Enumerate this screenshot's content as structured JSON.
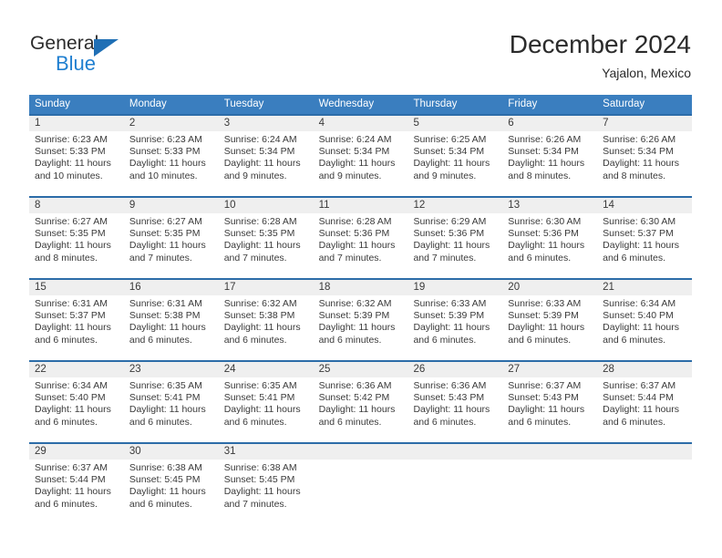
{
  "brand": {
    "name_part1": "General",
    "name_part2": "Blue",
    "triangle_icon": "triangle-icon",
    "accent_dark_blue": "#1f6fb5",
    "accent_blue": "#1f7fd0"
  },
  "header": {
    "title": "December 2024",
    "subtitle": "Yajalon, Mexico"
  },
  "theme": {
    "header_row_bg": "#3a7ebf",
    "cell_top_border": "#2c6ca8",
    "day_number_band_bg": "#efefef",
    "text": "#3a3a3a"
  },
  "calendar": {
    "weekday_headers": [
      "Sunday",
      "Monday",
      "Tuesday",
      "Wednesday",
      "Thursday",
      "Friday",
      "Saturday"
    ],
    "weeks": [
      [
        {
          "day": "1",
          "sunrise": "Sunrise: 6:23 AM",
          "sunset": "Sunset: 5:33 PM",
          "daylight_line1": "Daylight: 11 hours",
          "daylight_line2": "and 10 minutes."
        },
        {
          "day": "2",
          "sunrise": "Sunrise: 6:23 AM",
          "sunset": "Sunset: 5:33 PM",
          "daylight_line1": "Daylight: 11 hours",
          "daylight_line2": "and 10 minutes."
        },
        {
          "day": "3",
          "sunrise": "Sunrise: 6:24 AM",
          "sunset": "Sunset: 5:34 PM",
          "daylight_line1": "Daylight: 11 hours",
          "daylight_line2": "and 9 minutes."
        },
        {
          "day": "4",
          "sunrise": "Sunrise: 6:24 AM",
          "sunset": "Sunset: 5:34 PM",
          "daylight_line1": "Daylight: 11 hours",
          "daylight_line2": "and 9 minutes."
        },
        {
          "day": "5",
          "sunrise": "Sunrise: 6:25 AM",
          "sunset": "Sunset: 5:34 PM",
          "daylight_line1": "Daylight: 11 hours",
          "daylight_line2": "and 9 minutes."
        },
        {
          "day": "6",
          "sunrise": "Sunrise: 6:26 AM",
          "sunset": "Sunset: 5:34 PM",
          "daylight_line1": "Daylight: 11 hours",
          "daylight_line2": "and 8 minutes."
        },
        {
          "day": "7",
          "sunrise": "Sunrise: 6:26 AM",
          "sunset": "Sunset: 5:34 PM",
          "daylight_line1": "Daylight: 11 hours",
          "daylight_line2": "and 8 minutes."
        }
      ],
      [
        {
          "day": "8",
          "sunrise": "Sunrise: 6:27 AM",
          "sunset": "Sunset: 5:35 PM",
          "daylight_line1": "Daylight: 11 hours",
          "daylight_line2": "and 8 minutes."
        },
        {
          "day": "9",
          "sunrise": "Sunrise: 6:27 AM",
          "sunset": "Sunset: 5:35 PM",
          "daylight_line1": "Daylight: 11 hours",
          "daylight_line2": "and 7 minutes."
        },
        {
          "day": "10",
          "sunrise": "Sunrise: 6:28 AM",
          "sunset": "Sunset: 5:35 PM",
          "daylight_line1": "Daylight: 11 hours",
          "daylight_line2": "and 7 minutes."
        },
        {
          "day": "11",
          "sunrise": "Sunrise: 6:28 AM",
          "sunset": "Sunset: 5:36 PM",
          "daylight_line1": "Daylight: 11 hours",
          "daylight_line2": "and 7 minutes."
        },
        {
          "day": "12",
          "sunrise": "Sunrise: 6:29 AM",
          "sunset": "Sunset: 5:36 PM",
          "daylight_line1": "Daylight: 11 hours",
          "daylight_line2": "and 7 minutes."
        },
        {
          "day": "13",
          "sunrise": "Sunrise: 6:30 AM",
          "sunset": "Sunset: 5:36 PM",
          "daylight_line1": "Daylight: 11 hours",
          "daylight_line2": "and 6 minutes."
        },
        {
          "day": "14",
          "sunrise": "Sunrise: 6:30 AM",
          "sunset": "Sunset: 5:37 PM",
          "daylight_line1": "Daylight: 11 hours",
          "daylight_line2": "and 6 minutes."
        }
      ],
      [
        {
          "day": "15",
          "sunrise": "Sunrise: 6:31 AM",
          "sunset": "Sunset: 5:37 PM",
          "daylight_line1": "Daylight: 11 hours",
          "daylight_line2": "and 6 minutes."
        },
        {
          "day": "16",
          "sunrise": "Sunrise: 6:31 AM",
          "sunset": "Sunset: 5:38 PM",
          "daylight_line1": "Daylight: 11 hours",
          "daylight_line2": "and 6 minutes."
        },
        {
          "day": "17",
          "sunrise": "Sunrise: 6:32 AM",
          "sunset": "Sunset: 5:38 PM",
          "daylight_line1": "Daylight: 11 hours",
          "daylight_line2": "and 6 minutes."
        },
        {
          "day": "18",
          "sunrise": "Sunrise: 6:32 AM",
          "sunset": "Sunset: 5:39 PM",
          "daylight_line1": "Daylight: 11 hours",
          "daylight_line2": "and 6 minutes."
        },
        {
          "day": "19",
          "sunrise": "Sunrise: 6:33 AM",
          "sunset": "Sunset: 5:39 PM",
          "daylight_line1": "Daylight: 11 hours",
          "daylight_line2": "and 6 minutes."
        },
        {
          "day": "20",
          "sunrise": "Sunrise: 6:33 AM",
          "sunset": "Sunset: 5:39 PM",
          "daylight_line1": "Daylight: 11 hours",
          "daylight_line2": "and 6 minutes."
        },
        {
          "day": "21",
          "sunrise": "Sunrise: 6:34 AM",
          "sunset": "Sunset: 5:40 PM",
          "daylight_line1": "Daylight: 11 hours",
          "daylight_line2": "and 6 minutes."
        }
      ],
      [
        {
          "day": "22",
          "sunrise": "Sunrise: 6:34 AM",
          "sunset": "Sunset: 5:40 PM",
          "daylight_line1": "Daylight: 11 hours",
          "daylight_line2": "and 6 minutes."
        },
        {
          "day": "23",
          "sunrise": "Sunrise: 6:35 AM",
          "sunset": "Sunset: 5:41 PM",
          "daylight_line1": "Daylight: 11 hours",
          "daylight_line2": "and 6 minutes."
        },
        {
          "day": "24",
          "sunrise": "Sunrise: 6:35 AM",
          "sunset": "Sunset: 5:41 PM",
          "daylight_line1": "Daylight: 11 hours",
          "daylight_line2": "and 6 minutes."
        },
        {
          "day": "25",
          "sunrise": "Sunrise: 6:36 AM",
          "sunset": "Sunset: 5:42 PM",
          "daylight_line1": "Daylight: 11 hours",
          "daylight_line2": "and 6 minutes."
        },
        {
          "day": "26",
          "sunrise": "Sunrise: 6:36 AM",
          "sunset": "Sunset: 5:43 PM",
          "daylight_line1": "Daylight: 11 hours",
          "daylight_line2": "and 6 minutes."
        },
        {
          "day": "27",
          "sunrise": "Sunrise: 6:37 AM",
          "sunset": "Sunset: 5:43 PM",
          "daylight_line1": "Daylight: 11 hours",
          "daylight_line2": "and 6 minutes."
        },
        {
          "day": "28",
          "sunrise": "Sunrise: 6:37 AM",
          "sunset": "Sunset: 5:44 PM",
          "daylight_line1": "Daylight: 11 hours",
          "daylight_line2": "and 6 minutes."
        }
      ],
      [
        {
          "day": "29",
          "sunrise": "Sunrise: 6:37 AM",
          "sunset": "Sunset: 5:44 PM",
          "daylight_line1": "Daylight: 11 hours",
          "daylight_line2": "and 6 minutes."
        },
        {
          "day": "30",
          "sunrise": "Sunrise: 6:38 AM",
          "sunset": "Sunset: 5:45 PM",
          "daylight_line1": "Daylight: 11 hours",
          "daylight_line2": "and 6 minutes."
        },
        {
          "day": "31",
          "sunrise": "Sunrise: 6:38 AM",
          "sunset": "Sunset: 5:45 PM",
          "daylight_line1": "Daylight: 11 hours",
          "daylight_line2": "and 7 minutes."
        },
        {
          "day": "",
          "sunrise": "",
          "sunset": "",
          "daylight_line1": "",
          "daylight_line2": ""
        },
        {
          "day": "",
          "sunrise": "",
          "sunset": "",
          "daylight_line1": "",
          "daylight_line2": ""
        },
        {
          "day": "",
          "sunrise": "",
          "sunset": "",
          "daylight_line1": "",
          "daylight_line2": ""
        },
        {
          "day": "",
          "sunrise": "",
          "sunset": "",
          "daylight_line1": "",
          "daylight_line2": ""
        }
      ]
    ]
  }
}
